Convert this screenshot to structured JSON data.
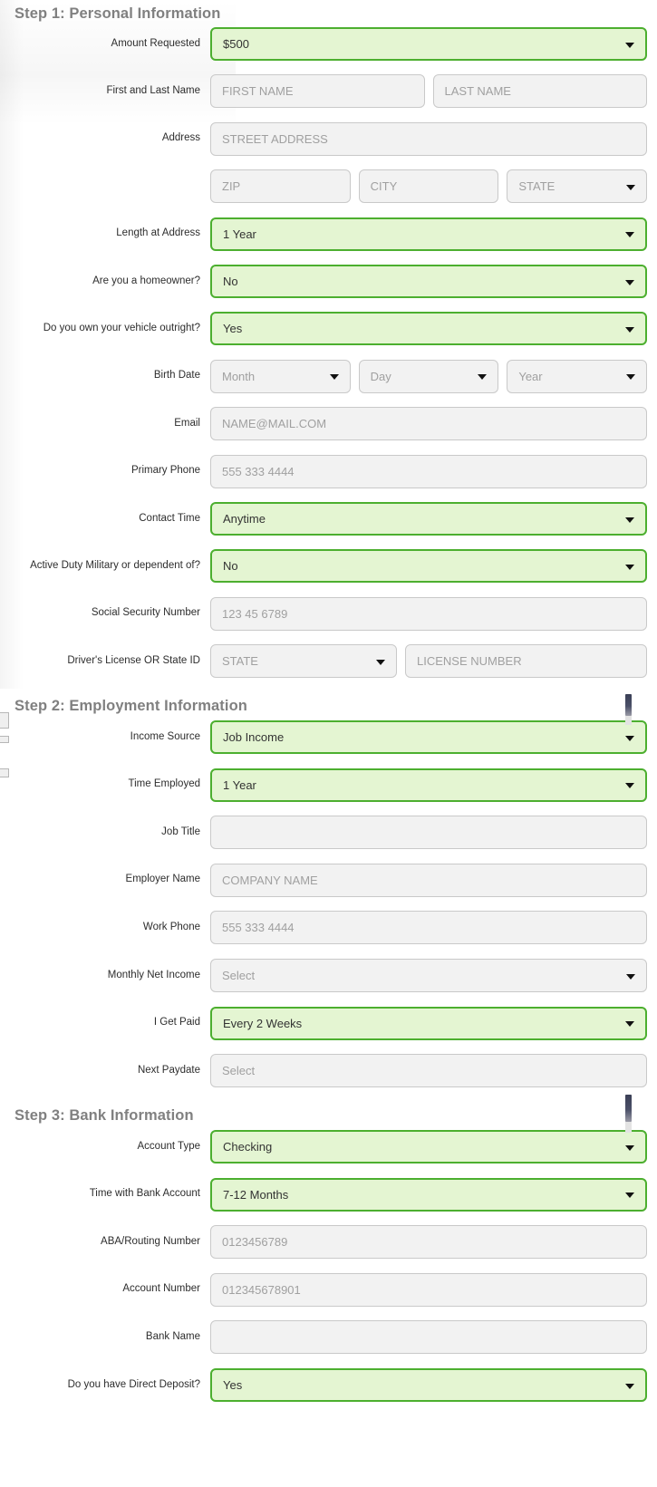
{
  "form": {
    "sections": [
      {
        "heading": "Step 1: Personal Information",
        "rows": [
          {
            "label": "Amount Requested",
            "controls": [
              {
                "kind": "select",
                "state": "filled",
                "value": "$500"
              }
            ]
          },
          {
            "label": "First and Last Name",
            "controls": [
              {
                "kind": "text",
                "state": "plain",
                "value": "FIRST NAME"
              },
              {
                "kind": "text",
                "state": "plain",
                "value": "LAST NAME"
              }
            ]
          },
          {
            "label": "Address",
            "controls": [
              {
                "kind": "text",
                "state": "plain",
                "value": "STREET ADDRESS"
              }
            ]
          },
          {
            "label": "",
            "controls": [
              {
                "kind": "text",
                "state": "plain",
                "value": "ZIP"
              },
              {
                "kind": "text",
                "state": "plain",
                "value": "CITY"
              },
              {
                "kind": "select",
                "state": "plain",
                "value": "STATE"
              }
            ]
          },
          {
            "label": "Length at Address",
            "controls": [
              {
                "kind": "select",
                "state": "filled",
                "value": "1 Year"
              }
            ]
          },
          {
            "label": "Are you a homeowner?",
            "controls": [
              {
                "kind": "select",
                "state": "filled",
                "value": "No"
              }
            ]
          },
          {
            "label": "Do you own your vehicle outright?",
            "controls": [
              {
                "kind": "select",
                "state": "filled",
                "value": "Yes"
              }
            ]
          },
          {
            "label": "Birth Date",
            "controls": [
              {
                "kind": "select",
                "state": "plain",
                "value": "Month"
              },
              {
                "kind": "select",
                "state": "plain",
                "value": "Day"
              },
              {
                "kind": "select",
                "state": "plain",
                "value": "Year"
              }
            ]
          },
          {
            "label": "Email",
            "controls": [
              {
                "kind": "text",
                "state": "plain",
                "value": "NAME@MAIL.COM"
              }
            ]
          },
          {
            "label": "Primary Phone",
            "controls": [
              {
                "kind": "text",
                "state": "plain",
                "value": "555 333 4444"
              }
            ]
          },
          {
            "label": "Contact Time",
            "controls": [
              {
                "kind": "select",
                "state": "filled",
                "value": "Anytime"
              }
            ]
          },
          {
            "label": "Active Duty Military or dependent of?",
            "controls": [
              {
                "kind": "select",
                "state": "filled",
                "value": "No"
              }
            ]
          },
          {
            "label": "Social Security Number",
            "controls": [
              {
                "kind": "text",
                "state": "plain",
                "value": "123 45 6789"
              }
            ]
          },
          {
            "label": "Driver's License OR State ID",
            "controls": [
              {
                "kind": "select",
                "state": "plain",
                "value": "STATE"
              },
              {
                "kind": "text",
                "state": "plain",
                "value": "LICENSE NUMBER"
              }
            ]
          }
        ]
      },
      {
        "heading": "Step 2: Employment Information",
        "rows": [
          {
            "label": "Income Source",
            "controls": [
              {
                "kind": "select",
                "state": "filled",
                "value": "Job Income"
              }
            ]
          },
          {
            "label": "Time Employed",
            "controls": [
              {
                "kind": "select",
                "state": "filled",
                "value": "1 Year"
              }
            ]
          },
          {
            "label": "Job Title",
            "controls": [
              {
                "kind": "text",
                "state": "plain",
                "value": ""
              }
            ]
          },
          {
            "label": "Employer Name",
            "controls": [
              {
                "kind": "text",
                "state": "plain",
                "value": "COMPANY NAME"
              }
            ]
          },
          {
            "label": "Work Phone",
            "controls": [
              {
                "kind": "text",
                "state": "plain",
                "value": "555 333 4444"
              }
            ]
          },
          {
            "label": "Monthly Net Income",
            "controls": [
              {
                "kind": "select",
                "state": "plain",
                "value": "Select"
              }
            ]
          },
          {
            "label": "I Get Paid",
            "controls": [
              {
                "kind": "select",
                "state": "filled",
                "value": "Every 2 Weeks"
              }
            ]
          },
          {
            "label": "Next Paydate",
            "controls": [
              {
                "kind": "text",
                "state": "plain",
                "value": "Select"
              }
            ]
          }
        ]
      },
      {
        "heading": "Step 3: Bank Information",
        "rows": [
          {
            "label": "Account Type",
            "controls": [
              {
                "kind": "select",
                "state": "filled",
                "value": "Checking"
              }
            ]
          },
          {
            "label": "Time with Bank Account",
            "controls": [
              {
                "kind": "select",
                "state": "filled",
                "value": "7-12 Months"
              }
            ]
          },
          {
            "label": "ABA/Routing Number",
            "controls": [
              {
                "kind": "text",
                "state": "plain",
                "value": "0123456789"
              }
            ]
          },
          {
            "label": "Account Number",
            "controls": [
              {
                "kind": "text",
                "state": "plain",
                "value": "012345678901"
              }
            ]
          },
          {
            "label": "Bank Name",
            "controls": [
              {
                "kind": "text",
                "state": "plain",
                "value": ""
              }
            ]
          },
          {
            "label": "Do you have Direct Deposit?",
            "controls": [
              {
                "kind": "select",
                "state": "filled",
                "value": "Yes"
              }
            ]
          }
        ]
      }
    ]
  },
  "colors": {
    "valid_border": "#4caf2f",
    "valid_background": "#e4f5d2",
    "neutral_border": "#c9c9c9",
    "neutral_background": "#f2f2f2",
    "heading_text": "#808080",
    "label_text": "#2d2d2d",
    "placeholder_text": "#a0a0a0"
  }
}
